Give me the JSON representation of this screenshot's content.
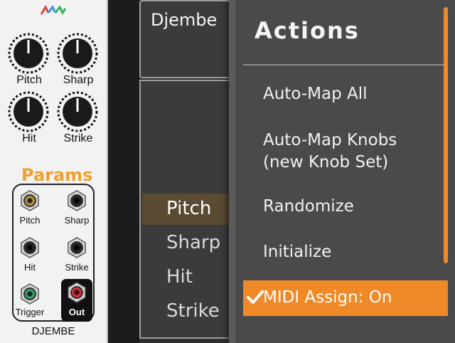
{
  "module": {
    "name": "DJEMBE",
    "knobs": [
      {
        "label": "Pitch"
      },
      {
        "label": "Sharp"
      },
      {
        "label": "Hit"
      },
      {
        "label": "Strike"
      }
    ],
    "jacks": [
      {
        "label": "Pitch"
      },
      {
        "label": "Sharp"
      },
      {
        "label": "Hit"
      },
      {
        "label": "Strike"
      },
      {
        "label": "Trigger"
      },
      {
        "label": "Out"
      }
    ],
    "logo_colors": [
      "#e8413c",
      "#3f8fe0",
      "#2fb85a"
    ]
  },
  "window": {
    "title": "Djembe",
    "params_heading": "Params",
    "params": [
      {
        "label": "Pitch",
        "selected": true
      },
      {
        "label": "Sharp"
      },
      {
        "label": "Hit"
      },
      {
        "label": "Strike"
      }
    ]
  },
  "menu": {
    "title": "Actions",
    "items": [
      {
        "label": "Auto-Map All"
      },
      {
        "label": "Auto-Map Knobs\n(new Knob Set)"
      },
      {
        "label": "Randomize"
      },
      {
        "label": "Initialize"
      },
      {
        "label": "MIDI Assign: On",
        "active": true,
        "checked": true
      }
    ]
  },
  "colors": {
    "accent": "#f08a28",
    "params_heading": "#f0a030",
    "menu_bg": "#4a4a4a",
    "window_bg": "#3b3b3b"
  }
}
